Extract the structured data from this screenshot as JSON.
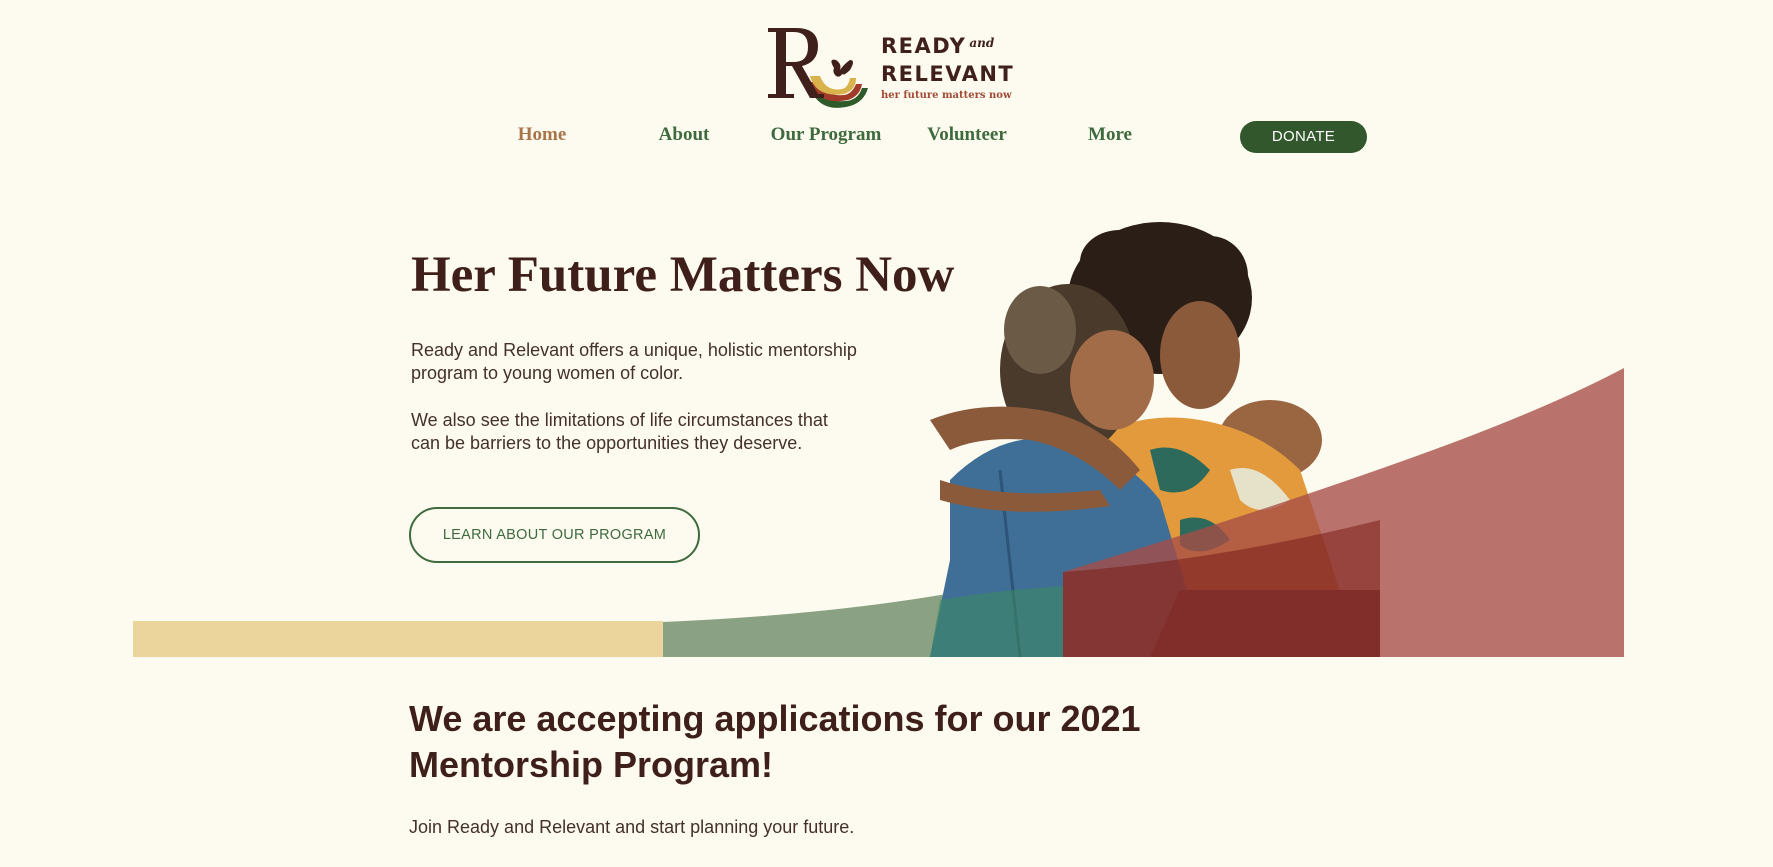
{
  "brand": {
    "line1": "READY",
    "and": "and",
    "line2": "RELEVANT",
    "tagline": "her future matters now"
  },
  "nav": {
    "items": [
      {
        "label": "Home",
        "active": true
      },
      {
        "label": "About",
        "active": false
      },
      {
        "label": "Our Program",
        "active": false
      },
      {
        "label": "Volunteer",
        "active": false
      },
      {
        "label": "More",
        "active": false
      }
    ],
    "donate_label": "DONATE"
  },
  "hero": {
    "title": "Her Future Matters Now",
    "paragraph1": "Ready and Relevant offers a unique, holistic mentorship program to young women of color.",
    "paragraph2": "We also see the limitations of life circumstances that can be barriers to the opportunities they deserve.",
    "cta_label": "LEARN ABOUT OUR PROGRAM",
    "image": "two-women-embracing-photo"
  },
  "announcement": {
    "title": "We are accepting applications for our 2021 Mentorship Program!",
    "subtitle": "Join Ready and Relevant and start planning your future."
  },
  "colors": {
    "background": "#fdfbef",
    "primary_green": "#33572c",
    "nav_green": "#3e6a3e",
    "active_nav": "#a8744a",
    "heading": "#3f1f1a",
    "band_yellow": "#ecd59c",
    "band_green": "#8aa283",
    "band_red": "#b36f69"
  }
}
